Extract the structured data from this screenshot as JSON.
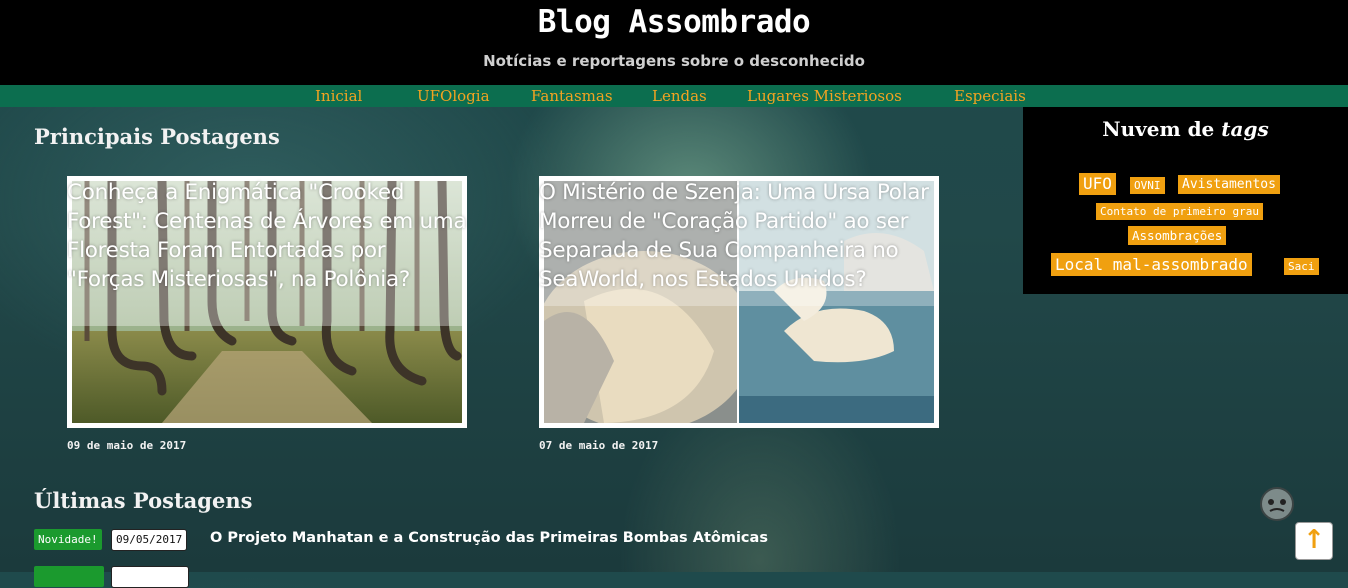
{
  "header": {
    "title": "Blog Assombrado",
    "subtitle": "Notícias e reportagens sobre o desconhecido"
  },
  "nav": {
    "items": [
      "Inicial",
      "UFOlogia",
      "Fantasmas",
      "Lendas",
      "Lugares Misteriosos",
      "Especiais"
    ]
  },
  "featured": {
    "heading": "Principais Postagens",
    "posts": [
      {
        "title": "Conheça a Enigmática \"Crooked Forest\": Centenas de Árvores em uma Floresta Foram Entortadas por \"Forças Misteriosas\", na Polônia?",
        "date": "09 de maio de 2017"
      },
      {
        "title": "O Mistério de Szenja: Uma Ursa Polar Morreu de \"Coração Partido\" ao ser Separada de Sua Companheira no SeaWorld, nos Estados Unidos?",
        "date": "07 de maio de 2017"
      }
    ]
  },
  "tags": {
    "title_plain": "Nuvem de",
    "title_italic": "tags",
    "items": [
      "UFO",
      "OVNI",
      "Avistamentos",
      "Contato de primeiro grau",
      "Assombrações",
      "Local mal-assombrado",
      "Saci"
    ]
  },
  "latest": {
    "heading": "Últimas Postagens",
    "posts": [
      {
        "badge": "Novidade!",
        "date": "09/05/2017",
        "title": "O Projeto Manhatan e a Construção das Primeiras Bombas Atômicas"
      }
    ]
  },
  "colors": {
    "accent": "#f0a010",
    "nav_bg": "#0c6e4f",
    "badge": "#1b9a2e"
  },
  "icons": {
    "back_to_top": "arrow-up-icon",
    "ghost": "ghost-icon"
  }
}
